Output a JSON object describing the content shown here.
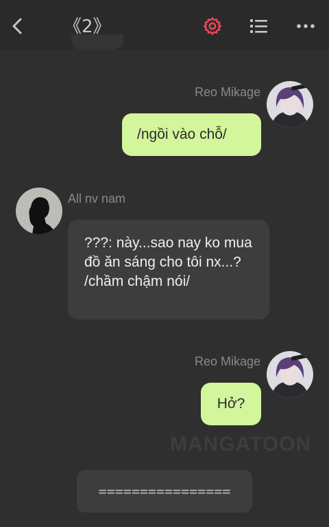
{
  "header": {
    "chapter": "《2》",
    "icons": [
      "back-icon",
      "settings-icon",
      "list-icon",
      "more-icon"
    ],
    "settings_color": "#e8455a"
  },
  "messages": [
    {
      "sender": "Reo Mikage",
      "side": "right",
      "text": "/ngồi vào chỗ/",
      "bubble_color": "#d3f59c"
    },
    {
      "sender": "All nv nam",
      "side": "left",
      "text": "???: này...sao nay ko mua đồ ăn sáng cho tôi nx...? /chầm chậm nói/",
      "bubble_color": "#3d3d3d"
    },
    {
      "sender": "Reo Mikage",
      "side": "right",
      "text": "Hở?",
      "bubble_color": "#d3f59c"
    }
  ],
  "watermark": "MANGATOON",
  "divider": "================"
}
